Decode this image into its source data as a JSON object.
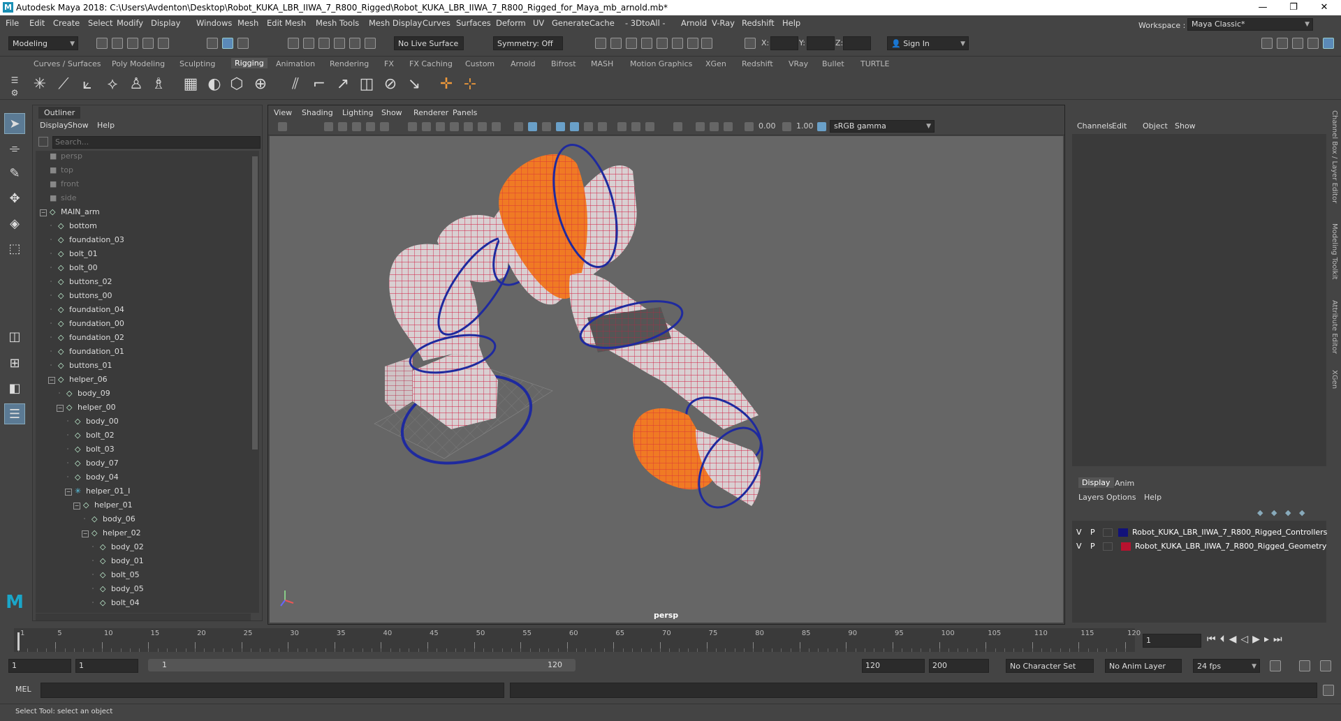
{
  "window": {
    "logo": "M",
    "title": "Autodesk Maya 2018: C:\\Users\\Avdenton\\Desktop\\Robot_KUKA_LBR_IIWA_7_R800_Rigged\\Robot_KUKA_LBR_IIWA_7_R800_Rigged_for_Maya_mb_arnold.mb*",
    "minimize": "—",
    "maximize": "❐",
    "close": "✕"
  },
  "menubar": [
    "File",
    "Edit",
    "Create",
    "Select",
    "Modify",
    "Display",
    "Windows",
    "Mesh",
    "Edit Mesh",
    "Mesh Tools",
    "Mesh Display",
    "Curves",
    "Surfaces",
    "Deform",
    "UV",
    "Generate",
    "Cache",
    "- 3DtoAll -",
    "Arnold",
    "V-Ray",
    "Redshift",
    "Help"
  ],
  "workspace": {
    "label": "Workspace :",
    "value": "Maya Classic*"
  },
  "statusline": {
    "mode": "Modeling",
    "live_surface": "No Live Surface",
    "symmetry": "Symmetry: Off",
    "x_label": "X:",
    "y_label": "Y:",
    "z_label": "Z:",
    "sign_in": "Sign In"
  },
  "shelf_tabs": [
    "Curves / Surfaces",
    "Poly Modeling",
    "Sculpting",
    "Rigging",
    "Animation",
    "Rendering",
    "FX",
    "FX Caching",
    "Custom",
    "Arnold",
    "Bifrost",
    "MASH",
    "Motion Graphics",
    "XGen",
    "Redshift",
    "VRay",
    "Bullet",
    "TURTLE"
  ],
  "shelf_active": "Rigging",
  "outliner": {
    "tab": "Outliner",
    "menus": [
      "Display",
      "Show",
      "Help"
    ],
    "search_placeholder": "Search...",
    "items": [
      {
        "label": "persp",
        "indent": 0,
        "cam": true,
        "toggle": ""
      },
      {
        "label": "top",
        "indent": 0,
        "cam": true,
        "toggle": ""
      },
      {
        "label": "front",
        "indent": 0,
        "cam": true,
        "toggle": ""
      },
      {
        "label": "side",
        "indent": 0,
        "cam": true,
        "toggle": ""
      },
      {
        "label": "MAIN_arm",
        "indent": 0,
        "toggle": "−"
      },
      {
        "label": "bottom",
        "indent": 1,
        "toggle": "+"
      },
      {
        "label": "foundation_03",
        "indent": 1,
        "toggle": "+"
      },
      {
        "label": "bolt_01",
        "indent": 1,
        "toggle": "+"
      },
      {
        "label": "bolt_00",
        "indent": 1,
        "toggle": "+"
      },
      {
        "label": "buttons_02",
        "indent": 1,
        "toggle": "+"
      },
      {
        "label": "buttons_00",
        "indent": 1,
        "toggle": "+"
      },
      {
        "label": "foundation_04",
        "indent": 1,
        "toggle": "+"
      },
      {
        "label": "foundation_00",
        "indent": 1,
        "toggle": "+"
      },
      {
        "label": "foundation_02",
        "indent": 1,
        "toggle": "+"
      },
      {
        "label": "foundation_01",
        "indent": 1,
        "toggle": "+"
      },
      {
        "label": "buttons_01",
        "indent": 1,
        "toggle": "+"
      },
      {
        "label": "helper_06",
        "indent": 1,
        "toggle": "−"
      },
      {
        "label": "body_09",
        "indent": 2,
        "toggle": "+"
      },
      {
        "label": "helper_00",
        "indent": 2,
        "toggle": "−"
      },
      {
        "label": "body_00",
        "indent": 3,
        "toggle": "+"
      },
      {
        "label": "bolt_02",
        "indent": 3,
        "toggle": "+"
      },
      {
        "label": "bolt_03",
        "indent": 3,
        "toggle": "+"
      },
      {
        "label": "body_07",
        "indent": 3,
        "toggle": "+"
      },
      {
        "label": "body_04",
        "indent": 3,
        "toggle": "+"
      },
      {
        "label": "helper_01_I",
        "indent": 3,
        "toggle": "−",
        "ik": true
      },
      {
        "label": "helper_01",
        "indent": 4,
        "toggle": "−"
      },
      {
        "label": "body_06",
        "indent": 5,
        "toggle": "+"
      },
      {
        "label": "helper_02",
        "indent": 5,
        "toggle": "−"
      },
      {
        "label": "body_02",
        "indent": 6,
        "toggle": "+"
      },
      {
        "label": "body_01",
        "indent": 6,
        "toggle": "+"
      },
      {
        "label": "bolt_05",
        "indent": 6,
        "toggle": "+"
      },
      {
        "label": "body_05",
        "indent": 6,
        "toggle": "+"
      },
      {
        "label": "bolt_04",
        "indent": 6,
        "toggle": "+"
      }
    ]
  },
  "viewport": {
    "menus": [
      "View",
      "Shading",
      "Lighting",
      "Show",
      "Renderer",
      "Panels"
    ],
    "exposure": "0.00",
    "gamma": "1.00",
    "colorspace": "sRGB gamma",
    "camera": "persp",
    "colors": {
      "body": "#d9d0d2",
      "orange": "#f07a24",
      "wire": "#d11a40",
      "ctrl": "#1f2a9e",
      "grid": "#888888"
    }
  },
  "channelbox": {
    "menus": [
      "Channels",
      "Edit",
      "Object",
      "Show"
    ],
    "layer_tabs": [
      "Display",
      "Anim"
    ],
    "layer_menus": [
      "Layers",
      "Options",
      "Help"
    ],
    "layers": [
      {
        "v": "V",
        "p": "P",
        "color": "#12127a",
        "name": "Robot_KUKA_LBR_IIWA_7_R800_Rigged_Controllers"
      },
      {
        "v": "V",
        "p": "P",
        "color": "#b8122e",
        "name": "Robot_KUKA_LBR_IIWA_7_R800_Rigged_Geometry"
      }
    ]
  },
  "side_tabs": [
    "Channel Box / Layer Editor",
    "Modeling Toolkit",
    "Attribute Editor",
    "XGen"
  ],
  "timeslider": {
    "ticks": [
      "1",
      "5",
      "10",
      "15",
      "20",
      "25",
      "30",
      "35",
      "40",
      "45",
      "50",
      "55",
      "60",
      "65",
      "70",
      "75",
      "80",
      "85",
      "90",
      "95",
      "100",
      "105",
      "110",
      "115",
      "120"
    ],
    "current_frame": "1"
  },
  "rangebar": {
    "start": "1",
    "anim_start": "1",
    "range_start": "1",
    "range_end": "120",
    "playback_end": "120",
    "anim_end": "200",
    "character_set": "No Character Set",
    "anim_layer": "No Anim Layer",
    "fps": "24 fps"
  },
  "cmdline": {
    "label": "MEL"
  },
  "helpline": {
    "text": "Select Tool: select an object"
  }
}
